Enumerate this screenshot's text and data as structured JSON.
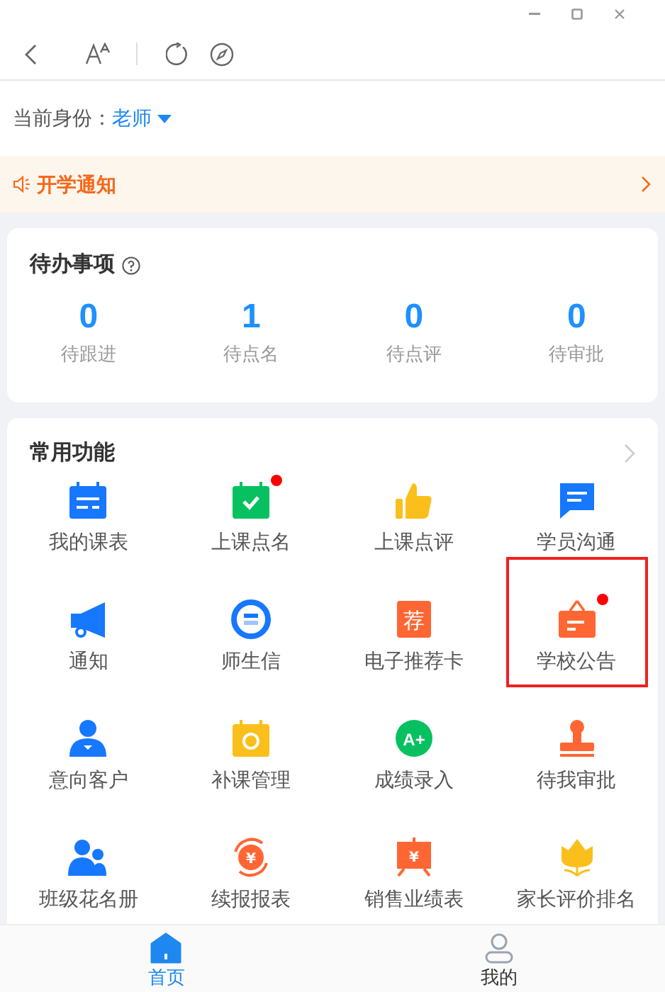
{
  "identity": {
    "label": "当前身份：",
    "value": "老师"
  },
  "notice": {
    "text": "开学通知"
  },
  "todo": {
    "title": "待办事项",
    "items": [
      {
        "count": "0",
        "label": "待跟进"
      },
      {
        "count": "1",
        "label": "待点名"
      },
      {
        "count": "0",
        "label": "待点评"
      },
      {
        "count": "0",
        "label": "待审批"
      }
    ]
  },
  "functions": {
    "title": "常用功能",
    "items": [
      {
        "label": "我的课表",
        "badge": false,
        "highlighted": false
      },
      {
        "label": "上课点名",
        "badge": true,
        "highlighted": false
      },
      {
        "label": "上课点评",
        "badge": false,
        "highlighted": false
      },
      {
        "label": "学员沟通",
        "badge": false,
        "highlighted": false
      },
      {
        "label": "通知",
        "badge": false,
        "highlighted": false
      },
      {
        "label": "师生信",
        "badge": false,
        "highlighted": false
      },
      {
        "label": "电子推荐卡",
        "badge": false,
        "highlighted": false,
        "glyph": "荐"
      },
      {
        "label": "学校公告",
        "badge": true,
        "highlighted": true
      },
      {
        "label": "意向客户",
        "badge": false,
        "highlighted": false
      },
      {
        "label": "补课管理",
        "badge": false,
        "highlighted": false
      },
      {
        "label": "成绩录入",
        "badge": false,
        "highlighted": false,
        "glyph": "A+"
      },
      {
        "label": "待我审批",
        "badge": false,
        "highlighted": false
      },
      {
        "label": "班级花名册",
        "badge": false,
        "highlighted": false
      },
      {
        "label": "续报报表",
        "badge": false,
        "highlighted": false,
        "glyph": "¥"
      },
      {
        "label": "销售业绩表",
        "badge": false,
        "highlighted": false,
        "glyph": "¥"
      },
      {
        "label": "家长评价排名",
        "badge": false,
        "highlighted": false
      }
    ]
  },
  "tabs": [
    {
      "label": "首页",
      "selected": true
    },
    {
      "label": "我的",
      "selected": false
    }
  ]
}
